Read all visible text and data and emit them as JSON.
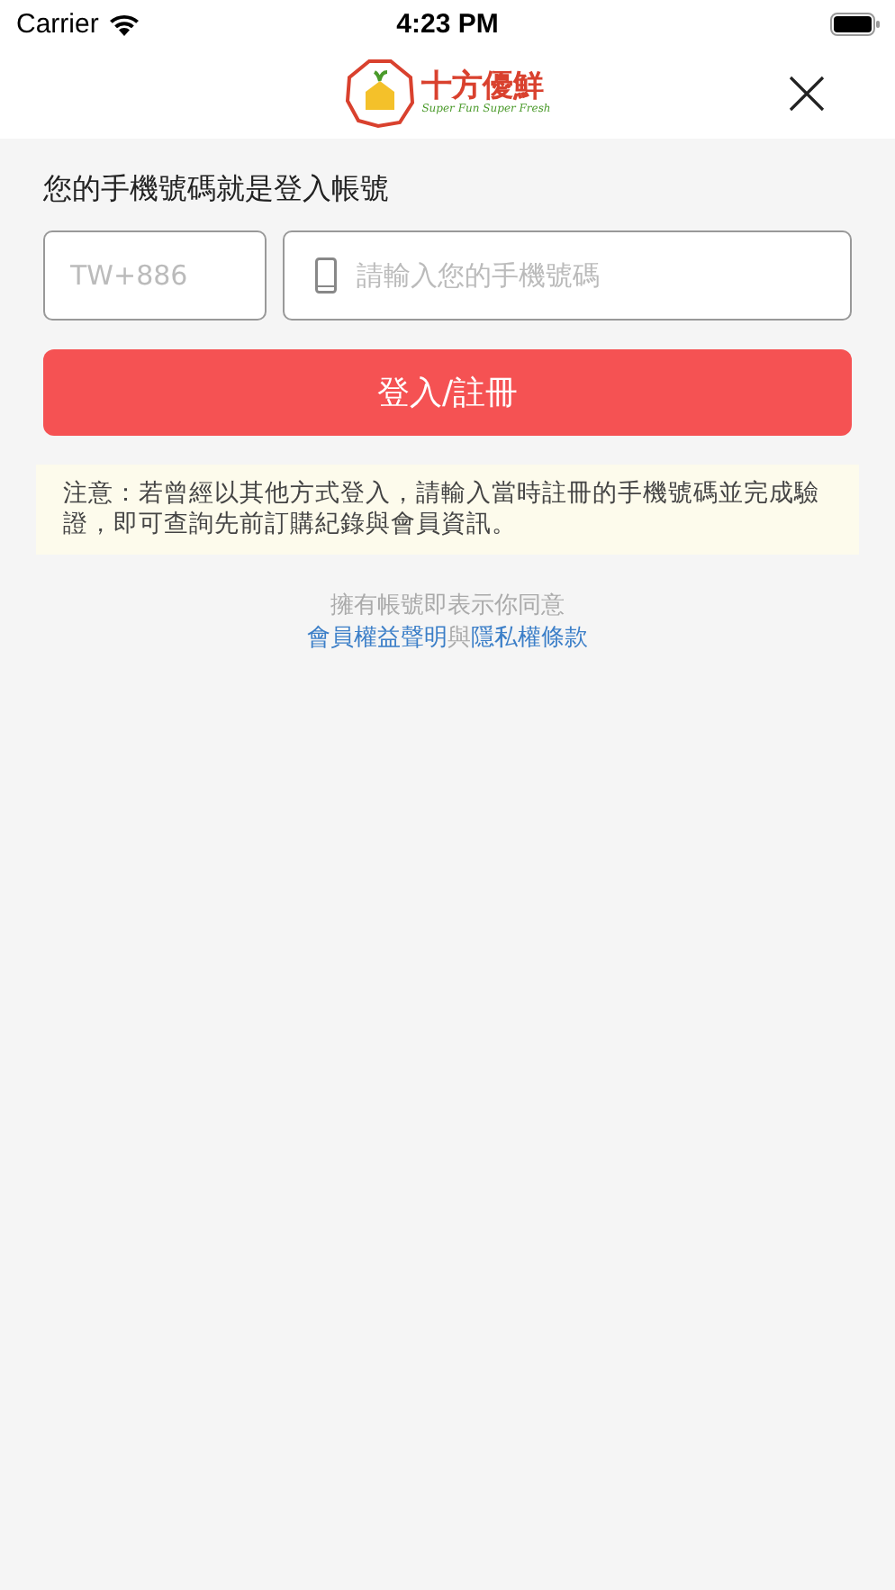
{
  "status_bar": {
    "carrier": "Carrier",
    "time": "4:23 PM"
  },
  "nav": {
    "logo_title": "十方優鮮",
    "logo_tagline": "Super Fun Super Fresh"
  },
  "heading": "您的手機號碼就是登入帳號",
  "country_field": {
    "placeholder": "TW+886"
  },
  "phone_field": {
    "placeholder": "請輸入您的手機號碼"
  },
  "submit_button": "登入/註冊",
  "notice": "注意：若曾經以其他方式登入，請輸入當時註冊的手機號碼並完成驗證，即可查詢先前訂購紀錄與會員資訊。",
  "agreement": {
    "intro": "擁有帳號即表示你同意",
    "link_1": "會員權益聲明",
    "joiner": "與",
    "link_2": "隱私權條款"
  }
}
